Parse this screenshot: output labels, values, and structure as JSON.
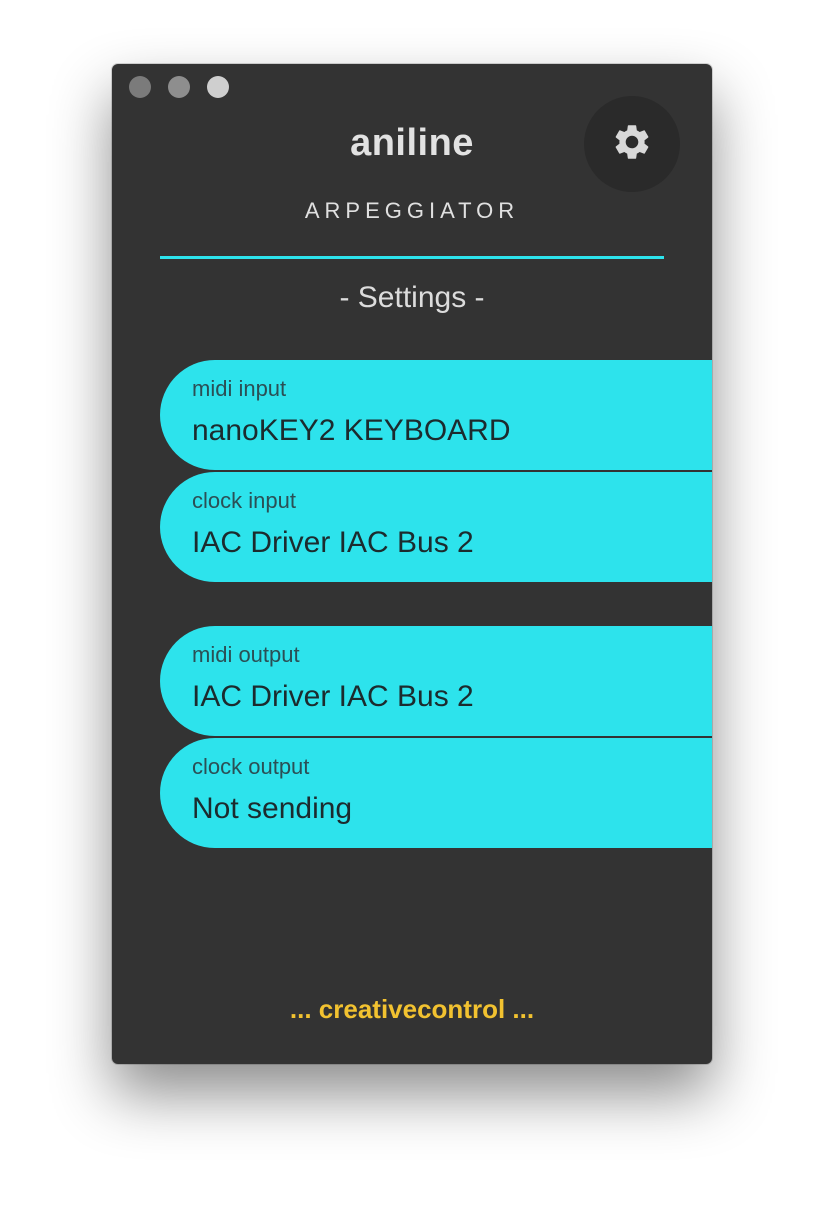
{
  "window": {
    "controls": [
      "close",
      "minimize",
      "maximize"
    ]
  },
  "header": {
    "title": "aniline",
    "subtitle": "ARPEGGIATOR",
    "settings_icon": "gear-icon"
  },
  "section": {
    "title": "- Settings -"
  },
  "fields": [
    {
      "label": "midi input",
      "value": "nanoKEY2 KEYBOARD"
    },
    {
      "label": "clock input",
      "value": "IAC Driver IAC Bus 2"
    },
    {
      "label": "midi output",
      "value": "IAC Driver IAC Bus 2"
    },
    {
      "label": "clock output",
      "value": "Not sending"
    }
  ],
  "footer": {
    "text": "... creativecontrol ..."
  },
  "colors": {
    "background": "#333333",
    "accent": "#2de3ec",
    "footer": "#f2c230"
  }
}
